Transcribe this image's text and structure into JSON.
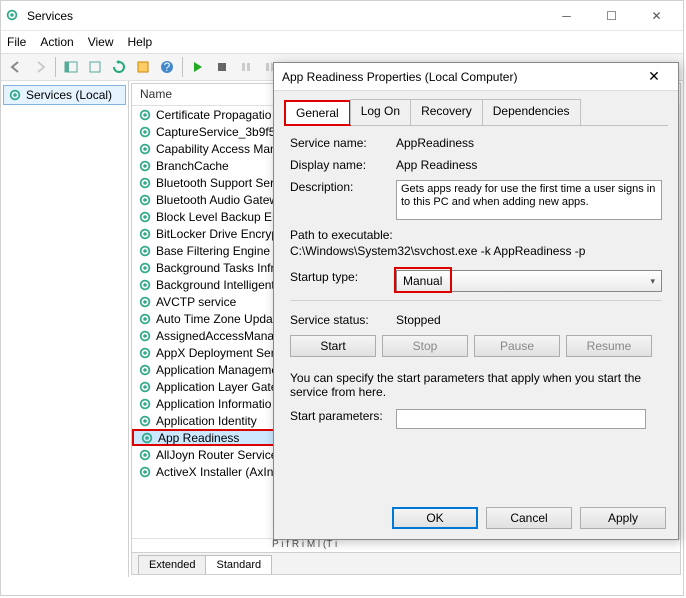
{
  "window": {
    "title": "Services",
    "menus": [
      "File",
      "Action",
      "View",
      "Help"
    ]
  },
  "tree": {
    "root_label": "Services (Local)"
  },
  "list": {
    "header_name": "Name",
    "footer_hint": "P             i     f          R         i            M         l (T    i",
    "items": [
      "ActiveX Installer (AxIns",
      "AllJoyn Router Service",
      "App Readiness",
      "Application Identity",
      "Application Informatio",
      "Application Layer Gate",
      "Application Manageme",
      "AppX Deployment Serv",
      "AssignedAccessManag",
      "Auto Time Zone Updat",
      "AVCTP service",
      "Background Intelligent",
      "Background Tasks Infra",
      "Base Filtering Engine",
      "BitLocker Drive Encrypt",
      "Block Level Backup En",
      "Bluetooth Audio Gatew",
      "Bluetooth Support Serv",
      "BranchCache",
      "Capability Access Man",
      "CaptureService_3b9f5",
      "Certificate Propagatio"
    ],
    "selected_index": 2
  },
  "bottom_tabs": {
    "extended": "Extended",
    "standard": "Standard"
  },
  "dialog": {
    "title": "App Readiness Properties (Local Computer)",
    "tabs": [
      "General",
      "Log On",
      "Recovery",
      "Dependencies"
    ],
    "labels": {
      "service_name": "Service name:",
      "display_name": "Display name:",
      "description": "Description:",
      "path": "Path to executable:",
      "startup": "Startup type:",
      "status": "Service status:",
      "params_hint": "You can specify the start parameters that apply when you start the service from here.",
      "start_params": "Start parameters:"
    },
    "values": {
      "service_name": "AppReadiness",
      "display_name": "App Readiness",
      "description": "Gets apps ready for use the first time a user signs in to this PC and when adding new apps.",
      "path": "C:\\Windows\\System32\\svchost.exe -k AppReadiness -p",
      "startup": "Manual",
      "status": "Stopped"
    },
    "buttons": {
      "start": "Start",
      "stop": "Stop",
      "pause": "Pause",
      "resume": "Resume",
      "ok": "OK",
      "cancel": "Cancel",
      "apply": "Apply"
    }
  }
}
